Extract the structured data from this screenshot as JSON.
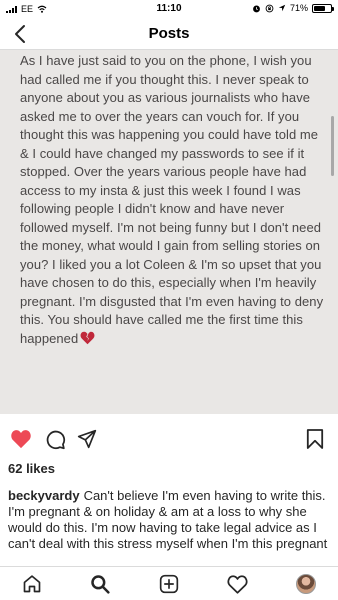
{
  "status_bar": {
    "carrier": "EE",
    "time": "11:10",
    "battery": "71%",
    "battery_level": 0.71
  },
  "nav": {
    "title": "Posts"
  },
  "post": {
    "image_text": "As I have just said to you on the phone, I wish you had called me if you thought this. I never speak to anyone about you as various journalists who have asked me to over the years can vouch for. If you thought this was happening you could have told me & I could have changed my passwords to see if it stopped. Over the years various people have had access to my insta & just this week I found I was following people I didn't know and have never followed myself. I'm not being funny but I don't need the money, what would I gain from selling stories on you? I liked you a lot Coleen & I'm so upset that you have chosen to do this, especially when I'm heavily pregnant. I'm disgusted that I'm even having to deny this. You should have called me the first time this happened",
    "likes": "62 likes",
    "caption_username": "beckyvardy",
    "caption_text": "Can't believe I'm even having to write this. I'm pregnant & on holiday & am at a loss to why she would do this. I'm now having to take legal advice as I can't deal with this stress myself when I'm this pregnant"
  },
  "colors": {
    "heart_red": "#ed4956",
    "broken_heart": "#c0283a",
    "image_background": "#e9e7e5",
    "image_text": "#4a4747",
    "divider": "#dbdbdb"
  },
  "icons": {
    "like": "heart-filled-icon",
    "comment": "comment-icon",
    "share": "paper-plane-icon",
    "save": "bookmark-icon",
    "home": "home-icon",
    "search": "search-icon",
    "new_post": "plus-square-icon",
    "activity": "heart-outline-icon",
    "profile": "avatar"
  }
}
